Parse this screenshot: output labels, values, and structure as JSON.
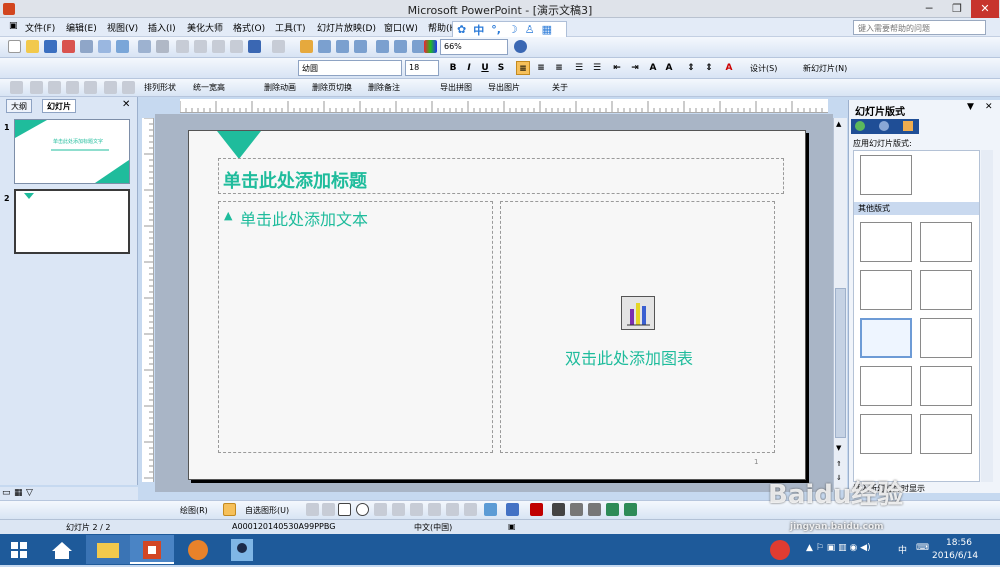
{
  "window": {
    "title": "Microsoft PowerPoint - [演示文稿3]"
  },
  "menu": {
    "items": [
      "文件(F)",
      "编辑(E)",
      "视图(V)",
      "插入(I)",
      "美化大师",
      "格式(O)",
      "工具(T)",
      "幻灯片放映(D)",
      "窗口(W)",
      "帮助(H)"
    ],
    "help_placeholder": "键入需要帮助的问题"
  },
  "ime": {
    "items": [
      "中"
    ]
  },
  "toolbar1": {
    "zoom": "66%"
  },
  "toolbar2": {
    "font": "幼圆",
    "size": "18",
    "design": "设计(S)",
    "new_slide": "新幻灯片(N)"
  },
  "toolbar3": {
    "items": [
      "排列形状",
      "统一宽高",
      "删除动画",
      "删除页切换",
      "删除备注",
      "导出拼图",
      "导出图片",
      "关于"
    ]
  },
  "leftpane": {
    "tab_outline": "大纲",
    "tab_slides": "幻灯片",
    "slide1_num": "1",
    "slide1_text": "单击此处添加标题文字",
    "slide2_num": "2"
  },
  "slide": {
    "title": "单击此处添加标题",
    "text_bullet": "▲",
    "text": "单击此处添加文本",
    "chart_text": "双击此处添加图表",
    "page_num": "1"
  },
  "taskpane": {
    "title": "幻灯片版式",
    "section1": "应用幻灯片版式:",
    "section2": "其他版式",
    "checkbox_label": "插入新幻灯片时显示"
  },
  "drawbar": {
    "draw": "绘图(R)",
    "autoshape": "自选图形(U)"
  },
  "statusbar": {
    "slide": "幻灯片 2 / 2",
    "design": "A000120140530A99PPBG",
    "lang": "中文(中国)"
  },
  "taskbar": {
    "time": "18:56",
    "date": "2016/6/14",
    "ime": "中"
  },
  "watermark": {
    "brand": "Baidu经验",
    "url": "jingyan.baidu.com"
  },
  "colors": {
    "accent": "#1fbc9c",
    "taskbar": "#1e5a9a"
  }
}
